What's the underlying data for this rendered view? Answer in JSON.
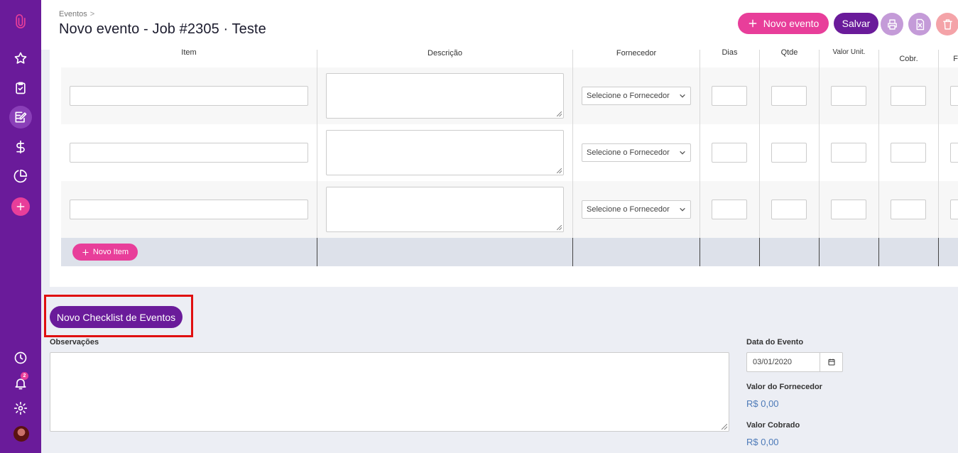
{
  "header": {
    "breadcrumb": "Eventos",
    "title": "Novo evento - Job #2305 · Teste",
    "new_event_label": "Novo evento",
    "save_label": "Salvar",
    "colors": {
      "accent": "#e83e9a",
      "brand": "#6a1b9a",
      "muted": "#c49bd8",
      "danger_muted": "#f4a3a8"
    }
  },
  "sidebar": {
    "icons": [
      "paperclip-icon",
      "star-icon",
      "clipboard-check-icon",
      "edit-icon",
      "dollar-icon",
      "pie-chart-icon",
      "plus-icon",
      "clock-icon",
      "bell-icon",
      "gear-icon",
      "avatar"
    ],
    "notification_count": "2"
  },
  "table": {
    "columns": [
      "Item",
      "Descrição",
      "Fornecedor",
      "Dias",
      "Qtde",
      "Valor Unit.",
      "Cobr.",
      "F"
    ],
    "rows": [
      {
        "item": "",
        "descricao": "",
        "fornecedor": "Selecione o Fornecedor",
        "dias": "",
        "qtde": "",
        "valor": "",
        "cobr": ""
      },
      {
        "item": "",
        "descricao": "",
        "fornecedor": "Selecione o Fornecedor",
        "dias": "",
        "qtde": "",
        "valor": "",
        "cobr": ""
      },
      {
        "item": "",
        "descricao": "",
        "fornecedor": "Selecione o Fornecedor",
        "dias": "",
        "qtde": "",
        "valor": "",
        "cobr": ""
      }
    ],
    "new_item_label": "Novo Item"
  },
  "checklist": {
    "button_label": "Novo Checklist de Eventos"
  },
  "observacoes": {
    "label": "Observações",
    "value": ""
  },
  "summary": {
    "date_label": "Data do Evento",
    "date_value": "03/01/2020",
    "supplier_value_label": "Valor do Fornecedor",
    "supplier_value": "R$ 0,00",
    "charged_value_label": "Valor Cobrado",
    "charged_value": "R$ 0,00"
  }
}
